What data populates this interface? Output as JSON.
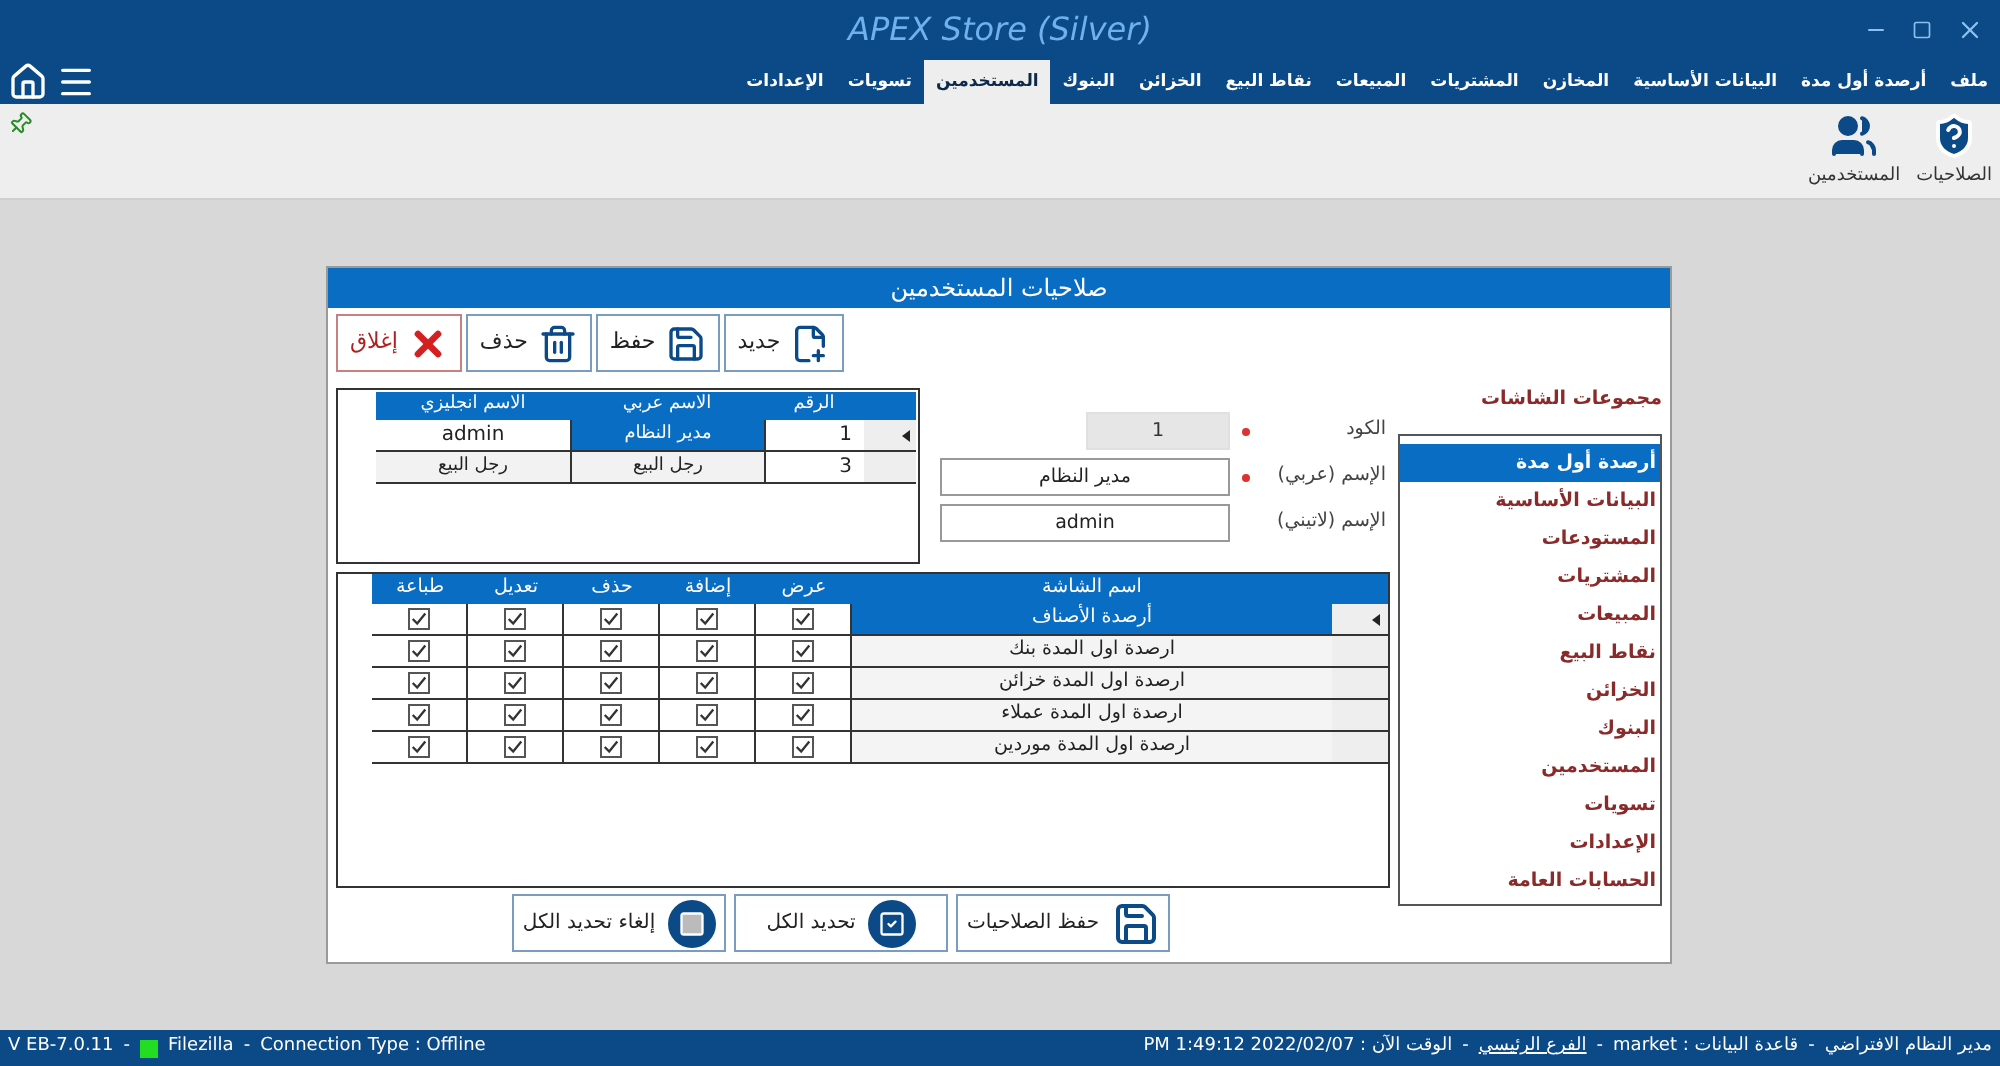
{
  "window": {
    "title": "APEX Store (Silver)"
  },
  "menu_tabs": [
    {
      "label": "ملف",
      "selected": false
    },
    {
      "label": "أرصدة أول مدة",
      "selected": false
    },
    {
      "label": "البيانات الأساسية",
      "selected": false
    },
    {
      "label": "المخازن",
      "selected": false
    },
    {
      "label": "المشتريات",
      "selected": false
    },
    {
      "label": "المبيعات",
      "selected": false
    },
    {
      "label": "نقاط البيع",
      "selected": false
    },
    {
      "label": "الخزائن",
      "selected": false
    },
    {
      "label": "البنوك",
      "selected": false
    },
    {
      "label": "المستخدمين",
      "selected": true
    },
    {
      "label": "تسويات",
      "selected": false
    },
    {
      "label": "الإعدادات",
      "selected": false
    }
  ],
  "ribbon": [
    {
      "label": "الصلاحيات",
      "kind": "permissions"
    },
    {
      "label": "المستخدمين",
      "kind": "users"
    }
  ],
  "dialog": {
    "title": "صلاحيات المستخدمين",
    "toolbar": [
      {
        "label": "جديد",
        "kind": "new"
      },
      {
        "label": "حفظ",
        "kind": "save"
      },
      {
        "label": "حذف",
        "kind": "delete"
      },
      {
        "label": "إغلاق",
        "kind": "close"
      }
    ],
    "users_grid": {
      "columns": [
        "الرقم",
        "الاسم عربي",
        "الاسم انجليزي"
      ],
      "rows": [
        {
          "number": "1",
          "arabic_name": "مدير النظام",
          "english_name": "admin",
          "selected": true
        },
        {
          "number": "3",
          "arabic_name": "رجل البيع",
          "english_name": "رجل البيع",
          "selected": false
        }
      ]
    },
    "form": [
      {
        "label": "الكود",
        "value": "1",
        "required": true,
        "disabled": true
      },
      {
        "label": "الإسم (عربي)",
        "value": "مدير النظام",
        "required": true,
        "disabled": false
      },
      {
        "label": "الإسم (لاتيني)",
        "value": "admin",
        "required": false,
        "disabled": false
      }
    ],
    "permissions_grid": {
      "columns": [
        "اسم الشاشة",
        "عرض",
        "إضافة",
        "حذف",
        "تعديل",
        "طباعة"
      ],
      "rows": [
        {
          "screen": "أرصدة الأصناف",
          "selected": true,
          "view": true,
          "add": true,
          "delete": true,
          "edit": true,
          "print": true
        },
        {
          "screen": "ارصدة اول المدة بنك",
          "selected": false,
          "view": true,
          "add": true,
          "delete": true,
          "edit": true,
          "print": true
        },
        {
          "screen": "ارصدة اول المدة خزائن",
          "selected": false,
          "view": true,
          "add": true,
          "delete": true,
          "edit": true,
          "print": true
        },
        {
          "screen": "ارصدة اول المدة عملاء",
          "selected": false,
          "view": true,
          "add": true,
          "delete": true,
          "edit": true,
          "print": true
        },
        {
          "screen": "ارصدة اول المدة موردين",
          "selected": false,
          "view": true,
          "add": true,
          "delete": true,
          "edit": true,
          "print": true
        }
      ]
    },
    "screen_groups": {
      "title": "مجموعات الشاشات",
      "items": [
        {
          "label": "أرصدة أول مدة",
          "selected": true
        },
        {
          "label": "البيانات الأساسية",
          "selected": false
        },
        {
          "label": "المستودعات",
          "selected": false
        },
        {
          "label": "المشتريات",
          "selected": false
        },
        {
          "label": "المبيعات",
          "selected": false
        },
        {
          "label": "نقاط البيع",
          "selected": false
        },
        {
          "label": "الخزائن",
          "selected": false
        },
        {
          "label": "البنوك",
          "selected": false
        },
        {
          "label": "المستخدمين",
          "selected": false
        },
        {
          "label": "تسويات",
          "selected": false
        },
        {
          "label": "الإعدادات",
          "selected": false
        },
        {
          "label": "الحسابات العامة",
          "selected": false
        }
      ]
    },
    "bottom_buttons": [
      {
        "label": "حفظ الصلاحيات",
        "kind": "save"
      },
      {
        "label": "تحديد الكل",
        "kind": "select_all"
      },
      {
        "label": "إلغاء تحديد الكل",
        "kind": "clear_all"
      }
    ]
  },
  "status_bar": {
    "separator": "-",
    "version": "V EB-7.0.11",
    "server": "Filezilla",
    "connection": "Connection Type :  Offline",
    "right": [
      {
        "text": "مدير النظام الافتراضي",
        "link": false
      },
      {
        "text": "قاعدة البيانات :  market",
        "link": false
      },
      {
        "text": "الفرع الرئيسي",
        "link": true
      },
      {
        "text": "الوقت الآن :  PM 1:49:12 2022/02/07",
        "link": false
      }
    ]
  }
}
